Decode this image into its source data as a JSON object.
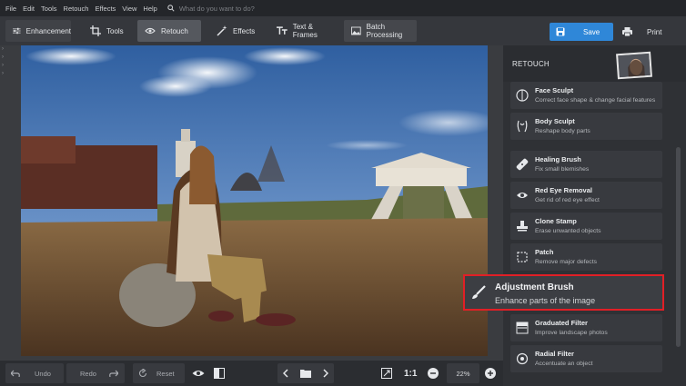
{
  "menu": [
    "File",
    "Edit",
    "Tools",
    "Retouch",
    "Effects",
    "View",
    "Help"
  ],
  "search": {
    "placeholder": "What do you want to do?"
  },
  "toolbar": {
    "tabs": [
      {
        "label": "Enhancement",
        "icon": "sliders-icon"
      },
      {
        "label": "Tools",
        "icon": "crop-icon"
      },
      {
        "label": "Retouch",
        "icon": "eye-retouch-icon",
        "active": true
      },
      {
        "label": "Effects",
        "icon": "magic-wand-icon"
      },
      {
        "label": "Text & Frames",
        "icon": "text-icon"
      },
      {
        "label": "Batch Processing",
        "icon": "images-icon"
      }
    ],
    "save_label": "Save",
    "print_label": "Print"
  },
  "panel": {
    "title": "RETOUCH",
    "tools": [
      {
        "name": "Face Sculpt",
        "desc": "Correct face shape & change facial features",
        "icon": "face-icon"
      },
      {
        "name": "Body Sculpt",
        "desc": "Reshape body parts",
        "icon": "body-icon"
      },
      {
        "name": "Healing Brush",
        "desc": "Fix small blemishes",
        "icon": "bandage-icon"
      },
      {
        "name": "Red Eye Removal",
        "desc": "Get rid of red eye effect",
        "icon": "eye-icon"
      },
      {
        "name": "Clone Stamp",
        "desc": "Erase unwanted objects",
        "icon": "stamp-icon"
      },
      {
        "name": "Patch",
        "desc": "Remove major defects",
        "icon": "patch-icon"
      },
      {
        "name": "Graduated Filter",
        "desc": "Improve landscape photos",
        "icon": "gradient-icon"
      },
      {
        "name": "Radial Filter",
        "desc": "Accentuate an object",
        "icon": "radial-icon"
      }
    ],
    "highlighted": {
      "name": "Adjustment Brush",
      "desc": "Enhance parts of the image",
      "icon": "brush-icon"
    }
  },
  "bottom": {
    "undo": "Undo",
    "redo": "Redo",
    "reset": "Reset",
    "ratio": "1:1",
    "zoom": "22%"
  },
  "colors": {
    "accent": "#2f87d8",
    "highlight_border": "#e11f26",
    "background": "#2b2d31"
  }
}
